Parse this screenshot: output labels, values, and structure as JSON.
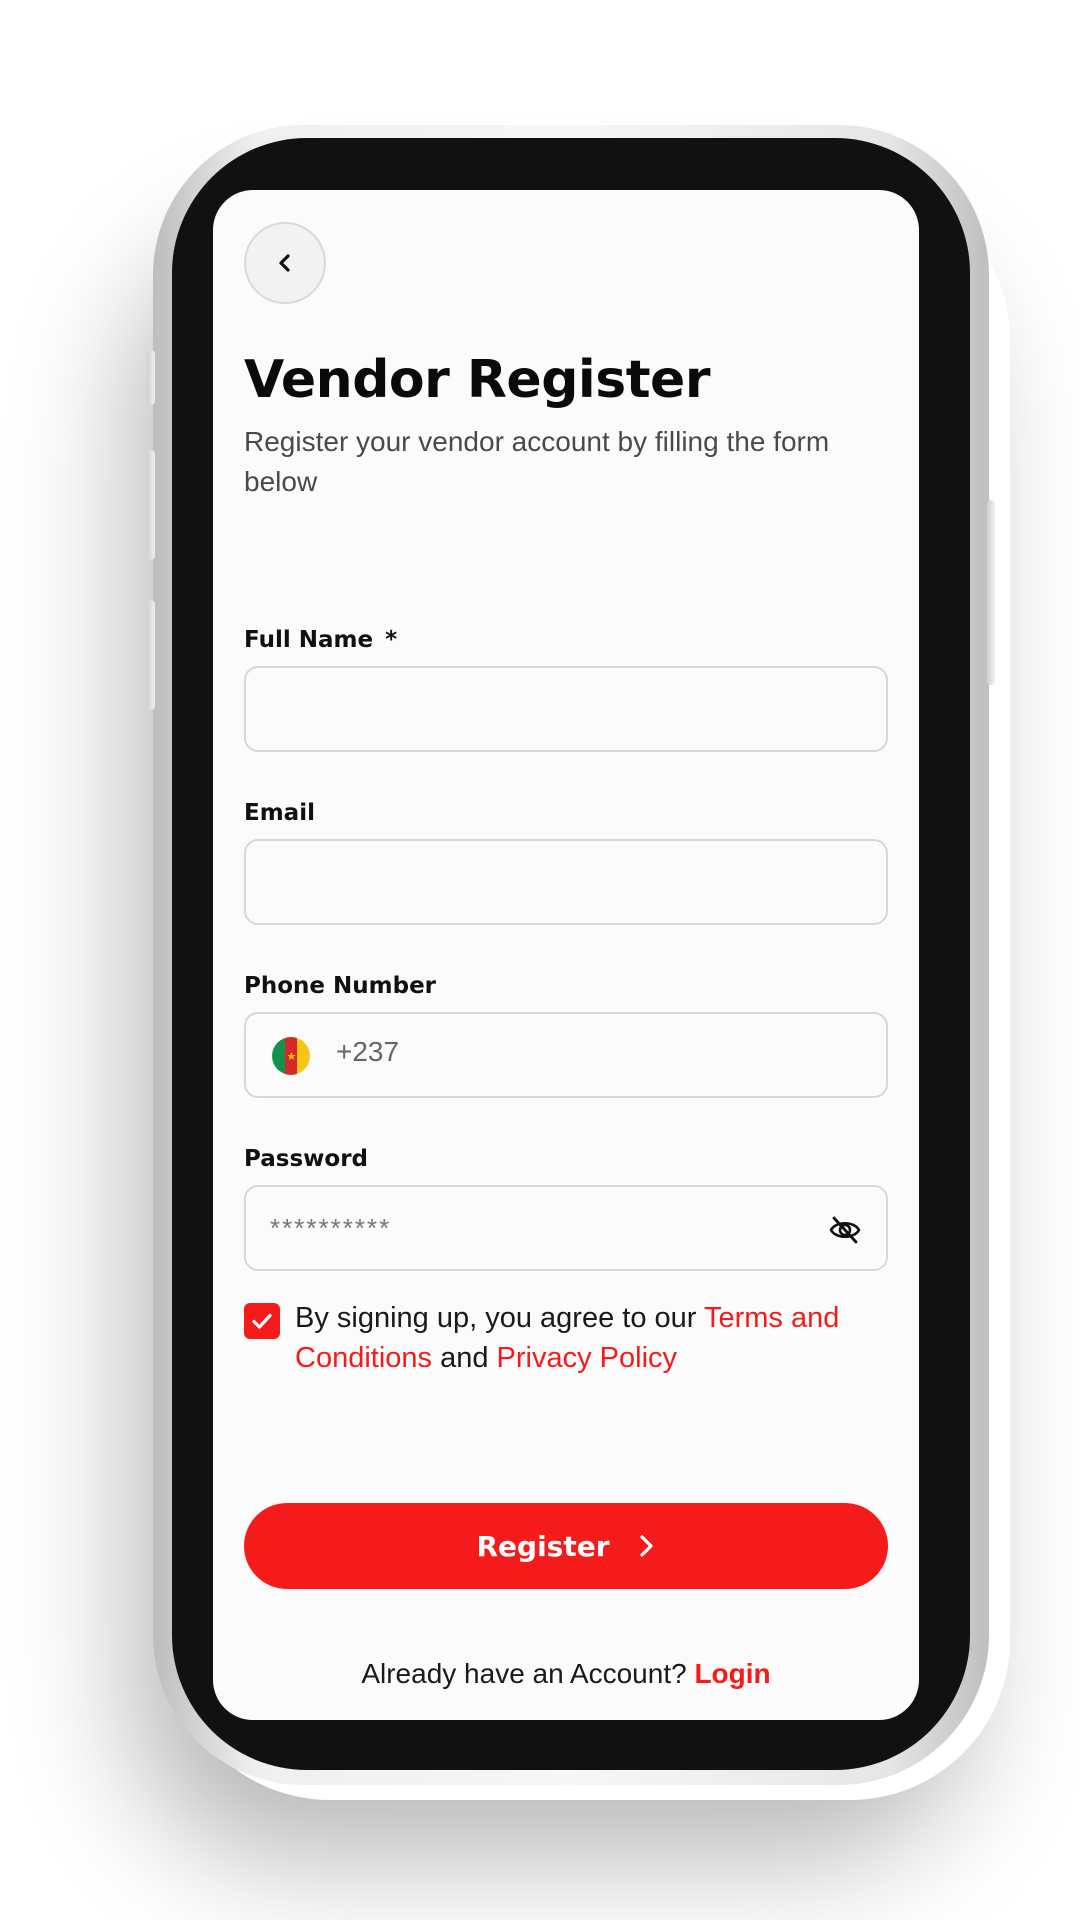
{
  "page": {
    "title": "Vendor Register",
    "subtitle": "Register your vendor account by filling the form below"
  },
  "form": {
    "full_name": {
      "label": "Full Name",
      "required_mark": "*",
      "value": ""
    },
    "email": {
      "label": "Email",
      "value": ""
    },
    "phone": {
      "label": "Phone Number",
      "dial_code": "+237",
      "flag_icon": "cameroon-flag-icon",
      "value": ""
    },
    "password": {
      "label": "Password",
      "masked_value": "**********",
      "toggle_icon": "eye-off-icon"
    },
    "agreement": {
      "checked": true,
      "prefix": "By signing up, you agree to our ",
      "terms_link": "Terms and Conditions",
      "joiner": " and ",
      "privacy_link": "Privacy Policy"
    },
    "submit_label": "Register"
  },
  "footer": {
    "prompt": "Already have an Account? ",
    "login_link": "Login"
  },
  "colors": {
    "accent": "#f51b1b",
    "flag_green": "#12924a",
    "flag_red": "#d62828",
    "flag_yellow": "#f5c518"
  }
}
